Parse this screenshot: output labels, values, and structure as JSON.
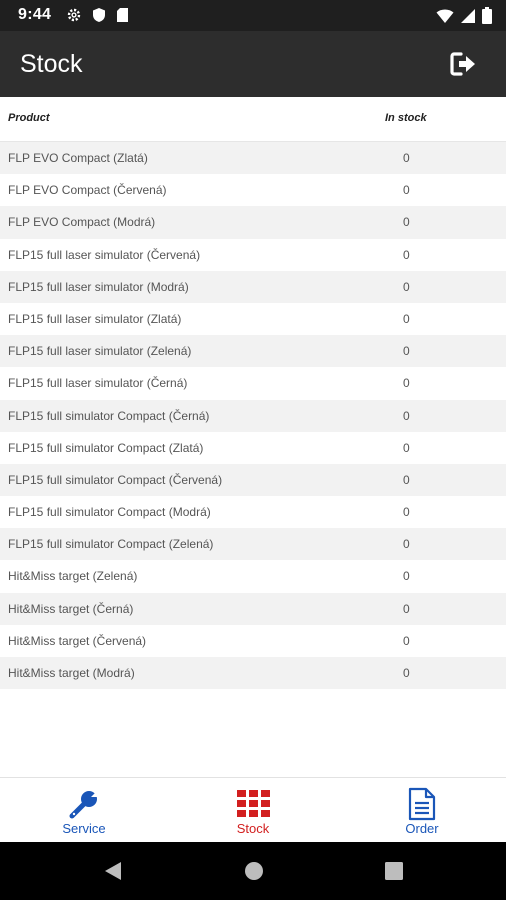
{
  "status_bar": {
    "time": "9:44",
    "icons_left": [
      "gear-icon",
      "shield-icon",
      "sd-card-icon"
    ],
    "icons_right": [
      "wifi-icon",
      "cellular-signal-icon",
      "battery-icon"
    ]
  },
  "app_bar": {
    "title": "Stock",
    "action_icon": "logout-icon"
  },
  "table": {
    "headers": {
      "product": "Product",
      "in_stock": "In stock"
    },
    "rows": [
      {
        "name": "FLP EVO Compact (Zlatá)",
        "qty": "0"
      },
      {
        "name": "FLP EVO Compact (Červená)",
        "qty": "0"
      },
      {
        "name": "FLP EVO Compact (Modrá)",
        "qty": "0"
      },
      {
        "name": "FLP15 full laser simulator (Červená)",
        "qty": "0"
      },
      {
        "name": "FLP15 full laser simulator (Modrá)",
        "qty": "0"
      },
      {
        "name": "FLP15 full laser simulator (Zlatá)",
        "qty": "0"
      },
      {
        "name": "FLP15 full laser simulator (Zelená)",
        "qty": "0"
      },
      {
        "name": "FLP15 full laser simulator (Černá)",
        "qty": "0"
      },
      {
        "name": "FLP15 full simulator Compact (Černá)",
        "qty": "0"
      },
      {
        "name": "FLP15 full simulator Compact (Zlatá)",
        "qty": "0"
      },
      {
        "name": "FLP15 full simulator Compact (Červená)",
        "qty": "0"
      },
      {
        "name": "FLP15 full simulator Compact (Modrá)",
        "qty": "0"
      },
      {
        "name": "FLP15 full simulator Compact (Zelená)",
        "qty": "0"
      },
      {
        "name": "Hit&Miss target (Zelená)",
        "qty": "0"
      },
      {
        "name": "Hit&Miss target (Černá)",
        "qty": "0"
      },
      {
        "name": "Hit&Miss target (Červená)",
        "qty": "0"
      },
      {
        "name": "Hit&Miss target (Modrá)",
        "qty": "0"
      }
    ]
  },
  "bottom_nav": {
    "items": [
      {
        "label": "Service",
        "icon": "wrench-icon",
        "color": "#1a56b8",
        "active": false
      },
      {
        "label": "Stock",
        "icon": "grid-icon",
        "color": "#d21f1f",
        "active": true
      },
      {
        "label": "Order",
        "icon": "document-icon",
        "color": "#1a56b8",
        "active": false
      }
    ]
  },
  "system_nav": {
    "buttons": [
      "back-icon",
      "home-icon",
      "recents-icon"
    ]
  },
  "colors": {
    "status_bar": "#1f1f1f",
    "app_bar": "#2d2d2d",
    "row_alt": "#f2f2f2",
    "accent_blue": "#1a56b8",
    "accent_red": "#d21f1f"
  }
}
